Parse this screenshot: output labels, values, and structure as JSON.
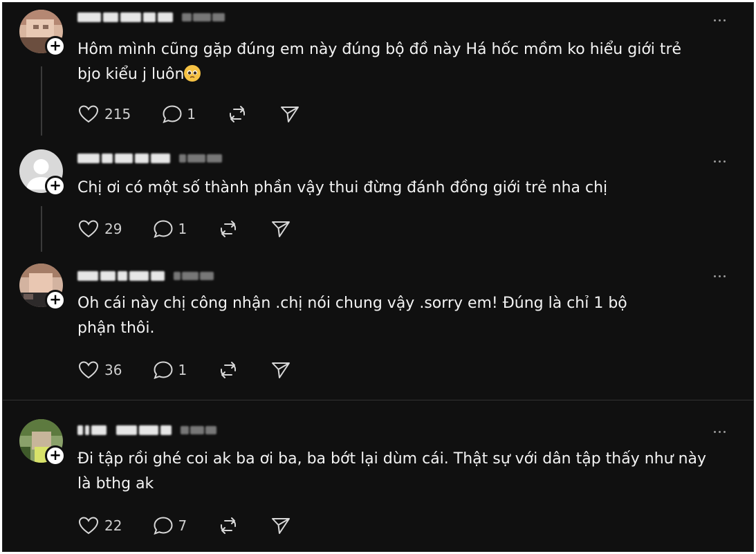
{
  "posts": [
    {
      "text": "Hôm mình cũng gặp đúng em này đúng bộ đồ này Há hốc mồm ko hiểu giới trẻ\nbjo kiểu j luôn",
      "emoji": "pleading-face",
      "likes": "215",
      "replies": "1",
      "avatar_color": "#c9a089"
    },
    {
      "text": "Chị ơi có một số thành phần vậy thui đừng đánh đồng giới trẻ nha chị",
      "likes": "29",
      "replies": "1",
      "avatar_color": "#d8d8d8"
    },
    {
      "text": "Oh cái này chị công nhận .chị nói chung vậy .sorry em! Đúng là chỉ 1 bộ\nphận thôi.",
      "likes": "36",
      "replies": "1",
      "avatar_color": "#b99580"
    },
    {
      "text": "Đi tập rồi ghé coi ak ba ơi ba, ba bớt lại dùm cái. Thật sự với dân tập thấy như này\nlà bthg ak",
      "likes": "22",
      "replies": "7",
      "avatar_color": "#6f8a52"
    }
  ],
  "colors": {
    "background": "#101010",
    "text": "#f3f3f3",
    "muted": "#9a9a9a"
  }
}
